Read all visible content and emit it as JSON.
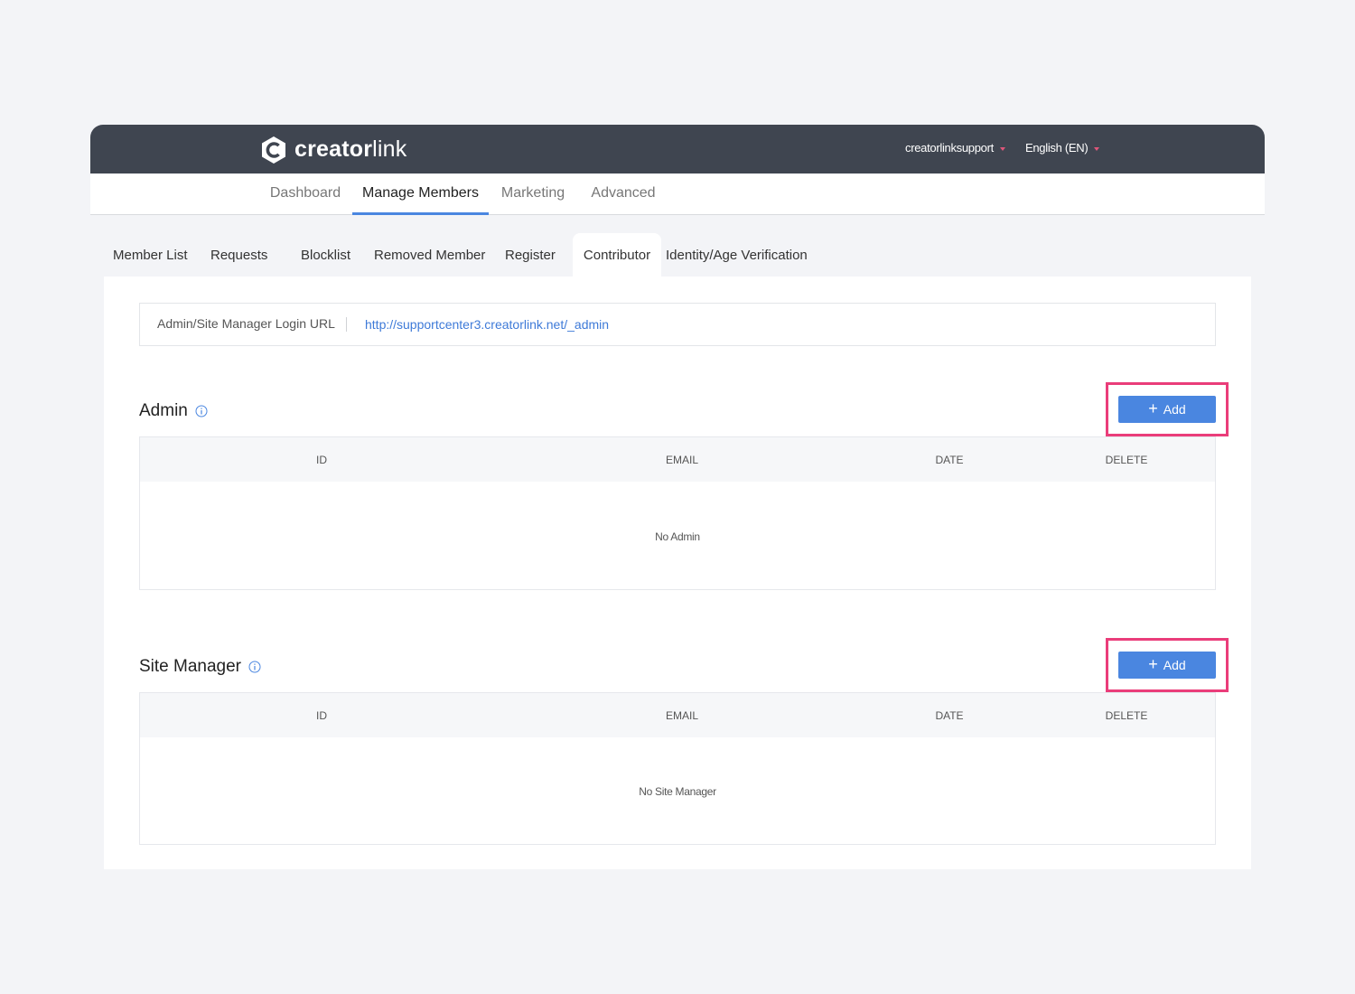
{
  "brand": {
    "name_bold": "creator",
    "name_light": "link",
    "accent_color": "#4a86e0",
    "highlight_color": "#ea3d7a"
  },
  "header": {
    "user": "creatorlinksupport",
    "language": "English (EN)"
  },
  "main_nav": {
    "tabs": [
      {
        "label": "Dashboard"
      },
      {
        "label": "Manage Members",
        "active": true
      },
      {
        "label": "Marketing"
      },
      {
        "label": "Advanced"
      }
    ]
  },
  "sub_nav": {
    "tabs": [
      {
        "label": "Member List"
      },
      {
        "label": "Requests"
      },
      {
        "label": "Blocklist"
      },
      {
        "label": "Removed Member"
      },
      {
        "label": "Register"
      },
      {
        "label": "Contributor",
        "active": true
      },
      {
        "label": "Identity/Age Verification"
      }
    ]
  },
  "login_url": {
    "label": "Admin/Site Manager Login URL",
    "url": "http://supportcenter3.creatorlink.net/_admin"
  },
  "admin_section": {
    "title": "Admin",
    "add_label": "Add",
    "columns": [
      "ID",
      "EMAIL",
      "DATE",
      "DELETE"
    ],
    "empty_message": "No Admin"
  },
  "site_manager_section": {
    "title": "Site Manager",
    "add_label": "Add",
    "columns": [
      "ID",
      "EMAIL",
      "DATE",
      "DELETE"
    ],
    "empty_message": "No Site Manager"
  }
}
